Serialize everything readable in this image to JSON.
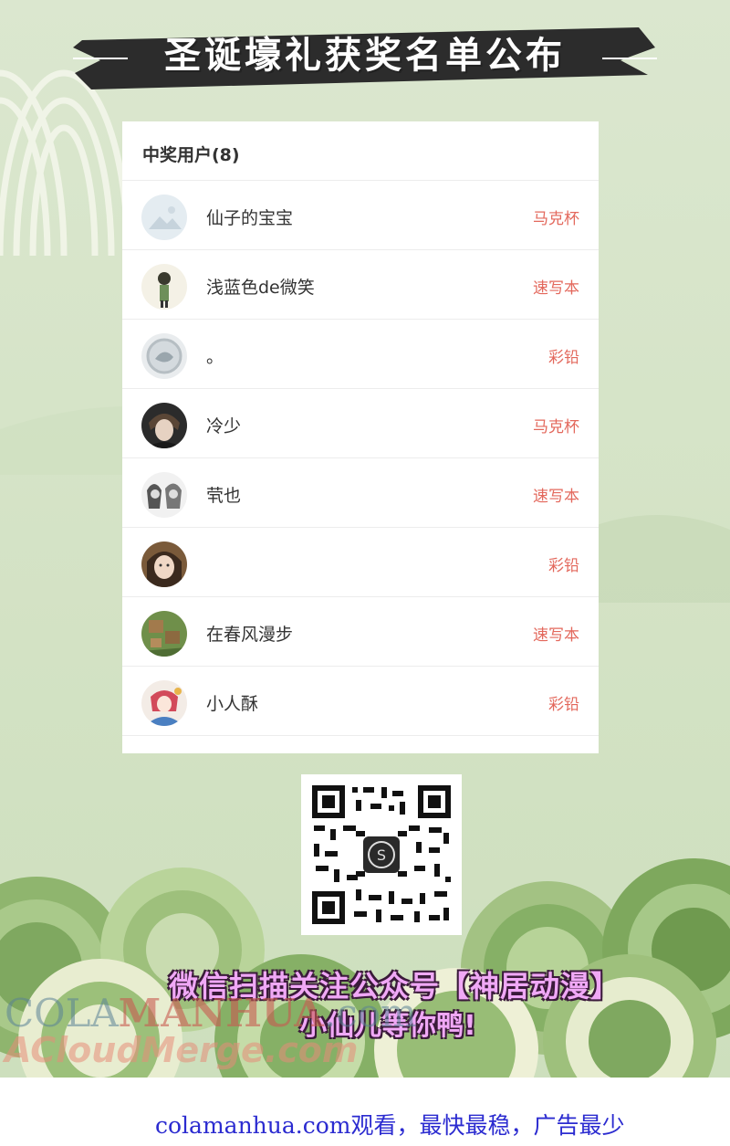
{
  "banner": {
    "title": "圣诞壕礼获奖名单公布"
  },
  "card": {
    "title": "中奖用户(8)",
    "winners": [
      {
        "name": "仙子的宝宝",
        "prize": "马克杯"
      },
      {
        "name": "浅蓝色de微笑",
        "prize": "速写本"
      },
      {
        "name": "。",
        "prize": "彩铅"
      },
      {
        "name": "冷少",
        "prize": "马克杯"
      },
      {
        "name": "茕也",
        "prize": "速写本"
      },
      {
        "name": "",
        "prize": "彩铅"
      },
      {
        "name": "在春风漫步",
        "prize": "速写本"
      },
      {
        "name": "小人酥",
        "prize": "彩铅"
      }
    ]
  },
  "promo": {
    "line1": "微信扫描关注公众号【神居动漫】",
    "line2": "小仙儿等你鸭!"
  },
  "watermark": {
    "line1a": "COLA",
    "line1b": "MANHUA",
    "line1c": ".com",
    "line2": "ACloudMerge.com"
  },
  "footer": {
    "text": "colamanhua.com观看，最快最稳，广告最少"
  },
  "colors": {
    "prize": "#e3685c",
    "footer_link": "#2b2bd0",
    "background": "#d6e4c8"
  }
}
